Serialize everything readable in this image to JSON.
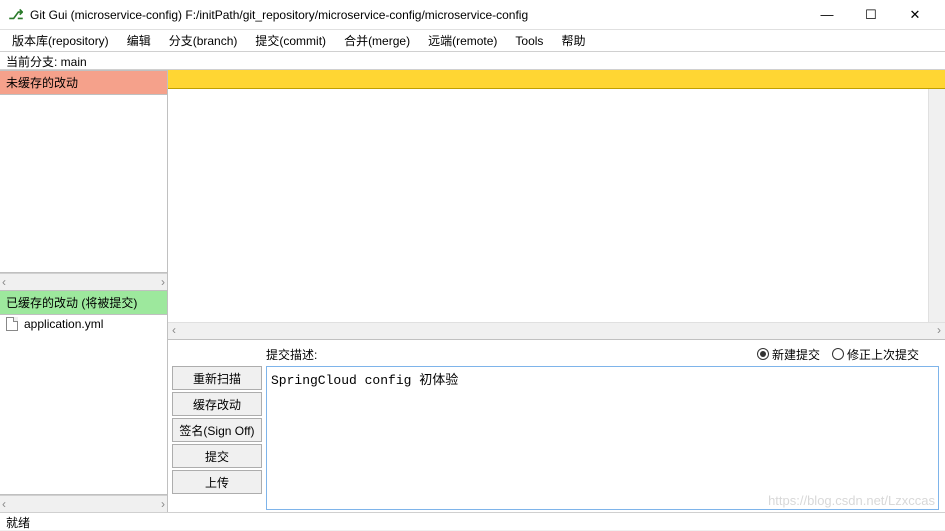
{
  "titlebar": {
    "icon_glyph": "⎇",
    "title": "Git Gui (microservice-config) F:/initPath/git_repository/microservice-config/microservice-config"
  },
  "window_controls": {
    "minimize": "—",
    "maximize": "☐",
    "close": "✕"
  },
  "menubar": {
    "items": [
      "版本库(repository)",
      "编辑",
      "分支(branch)",
      "提交(commit)",
      "合并(merge)",
      "远端(remote)",
      "Tools",
      "帮助"
    ]
  },
  "branch_info": {
    "label": "当前分支: main"
  },
  "panels": {
    "unstaged_header": "未缓存的改动",
    "staged_header": "已缓存的改动 (将被提交)"
  },
  "staged_files": [
    {
      "name": "application.yml"
    }
  ],
  "scroll_glyphs": {
    "left": "‹",
    "right": "›",
    "up": "˄",
    "down": "˅"
  },
  "commit": {
    "message_label": "提交描述:",
    "radio_new": "新建提交",
    "radio_amend": "修正上次提交",
    "message_value": "SpringCloud config 初体验",
    "buttons": {
      "rescan": "重新扫描",
      "stage": "缓存改动",
      "signoff": "签名(Sign Off)",
      "commit": "提交",
      "push": "上传"
    }
  },
  "statusbar": {
    "text": "就绪"
  },
  "watermark": "https://blog.csdn.net/Lzxccas"
}
